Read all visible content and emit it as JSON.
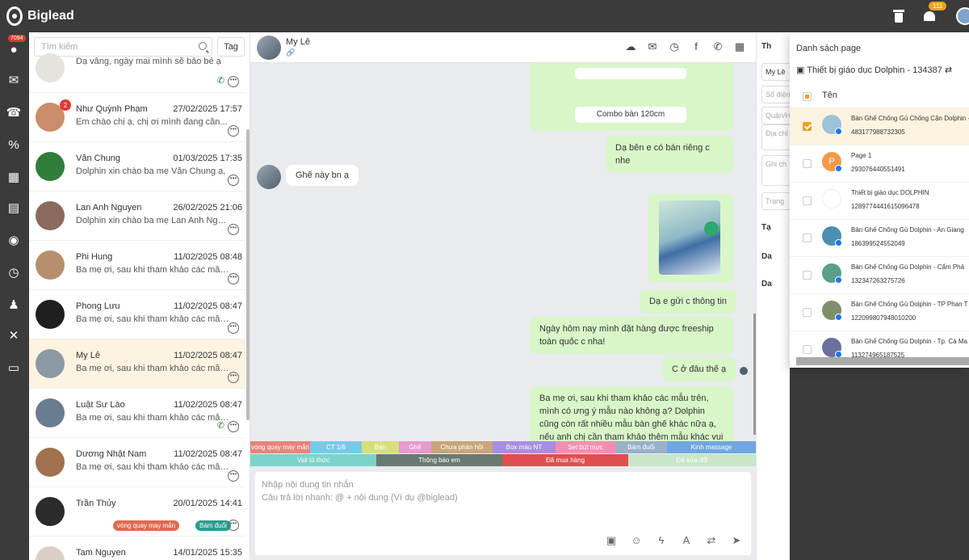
{
  "app": {
    "name": "Biglead",
    "notification_count": "111"
  },
  "rail": {
    "badge": "7094"
  },
  "search": {
    "placeholder": "Tìm kiếm",
    "tag_label": "Tag"
  },
  "conversations": [
    {
      "name": "",
      "time": "",
      "preview": "Dạ vâng, ngày mai mình sẽ bảo bé ạ",
      "avatar": "#e6e2dd"
    },
    {
      "name": "Như Quỳnh Phạm",
      "time": "27/02/2025 17:57",
      "preview": "Em chào chị ạ, chị ơi mình đang cần...",
      "badge": "2",
      "avatar": "#c98d6a"
    },
    {
      "name": "Văn Chung",
      "time": "01/03/2025 17:35",
      "preview": "Dolphin xin chào ba mẹ Văn Chung ạ,",
      "avatar": "#2f7d3a"
    },
    {
      "name": "Lan Anh Nguyen",
      "time": "26/02/2025 21:06",
      "preview": "Dolphin xin chào ba mẹ Lan Anh Nguy...",
      "avatar": "#8a6a5c"
    },
    {
      "name": "Phi Hung",
      "time": "11/02/2025 08:48",
      "preview": "Ba mẹ ơi, sau khi tham khảo các mẫu...",
      "avatar": "#b78f6c"
    },
    {
      "name": "Phong Lưu",
      "time": "11/02/2025 08:47",
      "preview": "Ba mẹ ơi, sau khi tham khảo các mẫu...",
      "avatar": "#1f1f1f"
    },
    {
      "name": "My Lê",
      "time": "11/02/2025 08:47",
      "preview": "Ba mẹ ơi, sau khi tham khảo các mẫu...",
      "avatar": "#8c9aa6"
    },
    {
      "name": "Luật Sư Lào",
      "time": "11/02/2025 08:47",
      "preview": "Ba mẹ ơi, sau khi tham khảo các mẫu...",
      "avatar": "#6a7d90"
    },
    {
      "name": "Dương Nhật Nam",
      "time": "11/02/2025 08:47",
      "preview": "Ba mẹ ơi, sau khi tham khảo các mẫu...",
      "avatar": "#a0724f"
    },
    {
      "name": "Trần Thủy",
      "time": "20/01/2025 14:41",
      "preview": "",
      "avatar": "#2b2b2b"
    },
    {
      "name": "Tam Nguyen",
      "time": "14/01/2025 15:35",
      "preview": "",
      "avatar": "#d9cfc5"
    }
  ],
  "conv_tags": {
    "t1": "vòng quay may mắn",
    "t2": "Bám đuổi"
  },
  "chat": {
    "contact_name": "My Lê",
    "chips": [
      "",
      "Combo bàn 120cm"
    ],
    "messages": {
      "m1": "Dạ bên e có bán riêng c nhe",
      "m2": "Ghế này bn ạ",
      "m3": "Dạ e gửi c thông tin",
      "m4": "Ngày hôm nay mình đặt hàng được freeship toàn quốc c nha!",
      "m5": "C ở đâu thế ạ",
      "m6": "Ba mẹ ơi, sau khi tham khảo các mẫu trên, mình có ưng ý mẫu nào không ạ? Dolphin cũng còn rất nhiều mẫu bàn ghế khác nữa ạ, nếu anh chị cần tham khảo thêm mẫu khác vui lòng chia sẻ cho em về nhu cầu và mong muốn của mình, em sẽ gửi thêm các mẫu khác phù hợp hơn ạ"
    }
  },
  "tags_row1": [
    {
      "label": "vòng quay may mắn",
      "color": "#e8837a"
    },
    {
      "label": "CT 1/6",
      "color": "#7ec6e8"
    },
    {
      "label": "Bàn",
      "color": "#d6e07a"
    },
    {
      "label": "Ghế",
      "color": "#e79ad1"
    },
    {
      "label": "Chưa phản hồi",
      "color": "#c9a57a"
    },
    {
      "label": "Box màu NT",
      "color": "#a88ee0"
    },
    {
      "label": "Set bút mực",
      "color": "#f28fb0"
    },
    {
      "label": "Bám đuổi",
      "color": "#9bb0c9"
    },
    {
      "label": "Kinh massage",
      "color": "#6fa7e0"
    }
  ],
  "tags_row2": [
    {
      "label": "Vali tủ thức",
      "color": "#7dd3c9"
    },
    {
      "label": "Thông báo em",
      "color": "#6a7a72"
    },
    {
      "label": "Đã mua hàng",
      "color": "#e04f4f"
    },
    {
      "label": "Đã sửa đổi",
      "color": "#c8e6c9"
    }
  ],
  "composer": {
    "placeholder": "Nhập nội dung tin nhắn",
    "hint": "Câu trả lời nhanh: @ + nội dung (Ví dụ @biglead)"
  },
  "info": {
    "section": "Th",
    "fields": [
      "My Lê",
      "Số điện",
      "Quận/H",
      "Địa chỉ",
      "Ghi ch",
      "Trạng"
    ],
    "groups": [
      "Tạ",
      "Da",
      "Da"
    ]
  },
  "pages": {
    "title": "Danh sách page",
    "selected": "Thiết bị giáo dục Dolphin - 134387",
    "column": "Tên",
    "items": [
      {
        "name": "Bàn Ghế Chống Gù Chống Cận Dolphin -",
        "id": "483177988732305",
        "checked": true,
        "avatar": "#9cc3d9"
      },
      {
        "name": "Page 1",
        "id": "293076440551491",
        "checked": false,
        "avatar": "#f39a4a",
        "letter": "P"
      },
      {
        "name": "Thiết bị giáo dục DOLPHIN",
        "id": "128977444161509647​8",
        "checked": false,
        "avatar": "#ffffff"
      },
      {
        "name": "Bàn Ghế Chống Gù Dolphin - An Giang",
        "id": "186399524552049",
        "checked": false,
        "avatar": "#4d8fb0"
      },
      {
        "name": "Bàn Ghế Chống Gù Dolphin - Cẩm Phả",
        "id": "132347263275726",
        "checked": false,
        "avatar": "#5a9e8c"
      },
      {
        "name": "Bàn Ghế Chống Gù Dolphin - TP Phan T",
        "id": "122099807948010200",
        "checked": false,
        "avatar": "#7f8f6a"
      },
      {
        "name": "Bàn Ghế Chống Gù Dolphin - Tp. Cà Ma",
        "id": "113274965187525",
        "checked": false,
        "avatar": "#6a6f9e"
      }
    ]
  }
}
